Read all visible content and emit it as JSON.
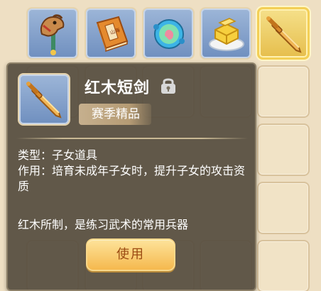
{
  "tooltip": {
    "item_name": "红木短剑",
    "badge": "赛季精品",
    "type_line": "类型：子女道具",
    "effect_line": "作用：培育未成年子女时，提升子女的攻击资质",
    "flavor": "红木所制，是练习武术的常用兵器",
    "use_button": "使用"
  },
  "inventory": {
    "items": [
      {
        "icon": "toy-hobby-horse-icon"
      },
      {
        "icon": "book-icon",
        "cover_text": "山海"
      },
      {
        "icon": "candy-icon"
      },
      {
        "icon": "cake-plate-icon"
      },
      {
        "icon": "wooden-sword-icon",
        "selected": true
      }
    ]
  },
  "colors": {
    "slot_blue": "#7e9cc9",
    "selected_gold": "#f3cf56",
    "panel_bg": "#564e40",
    "button_text": "#9a4a12"
  }
}
